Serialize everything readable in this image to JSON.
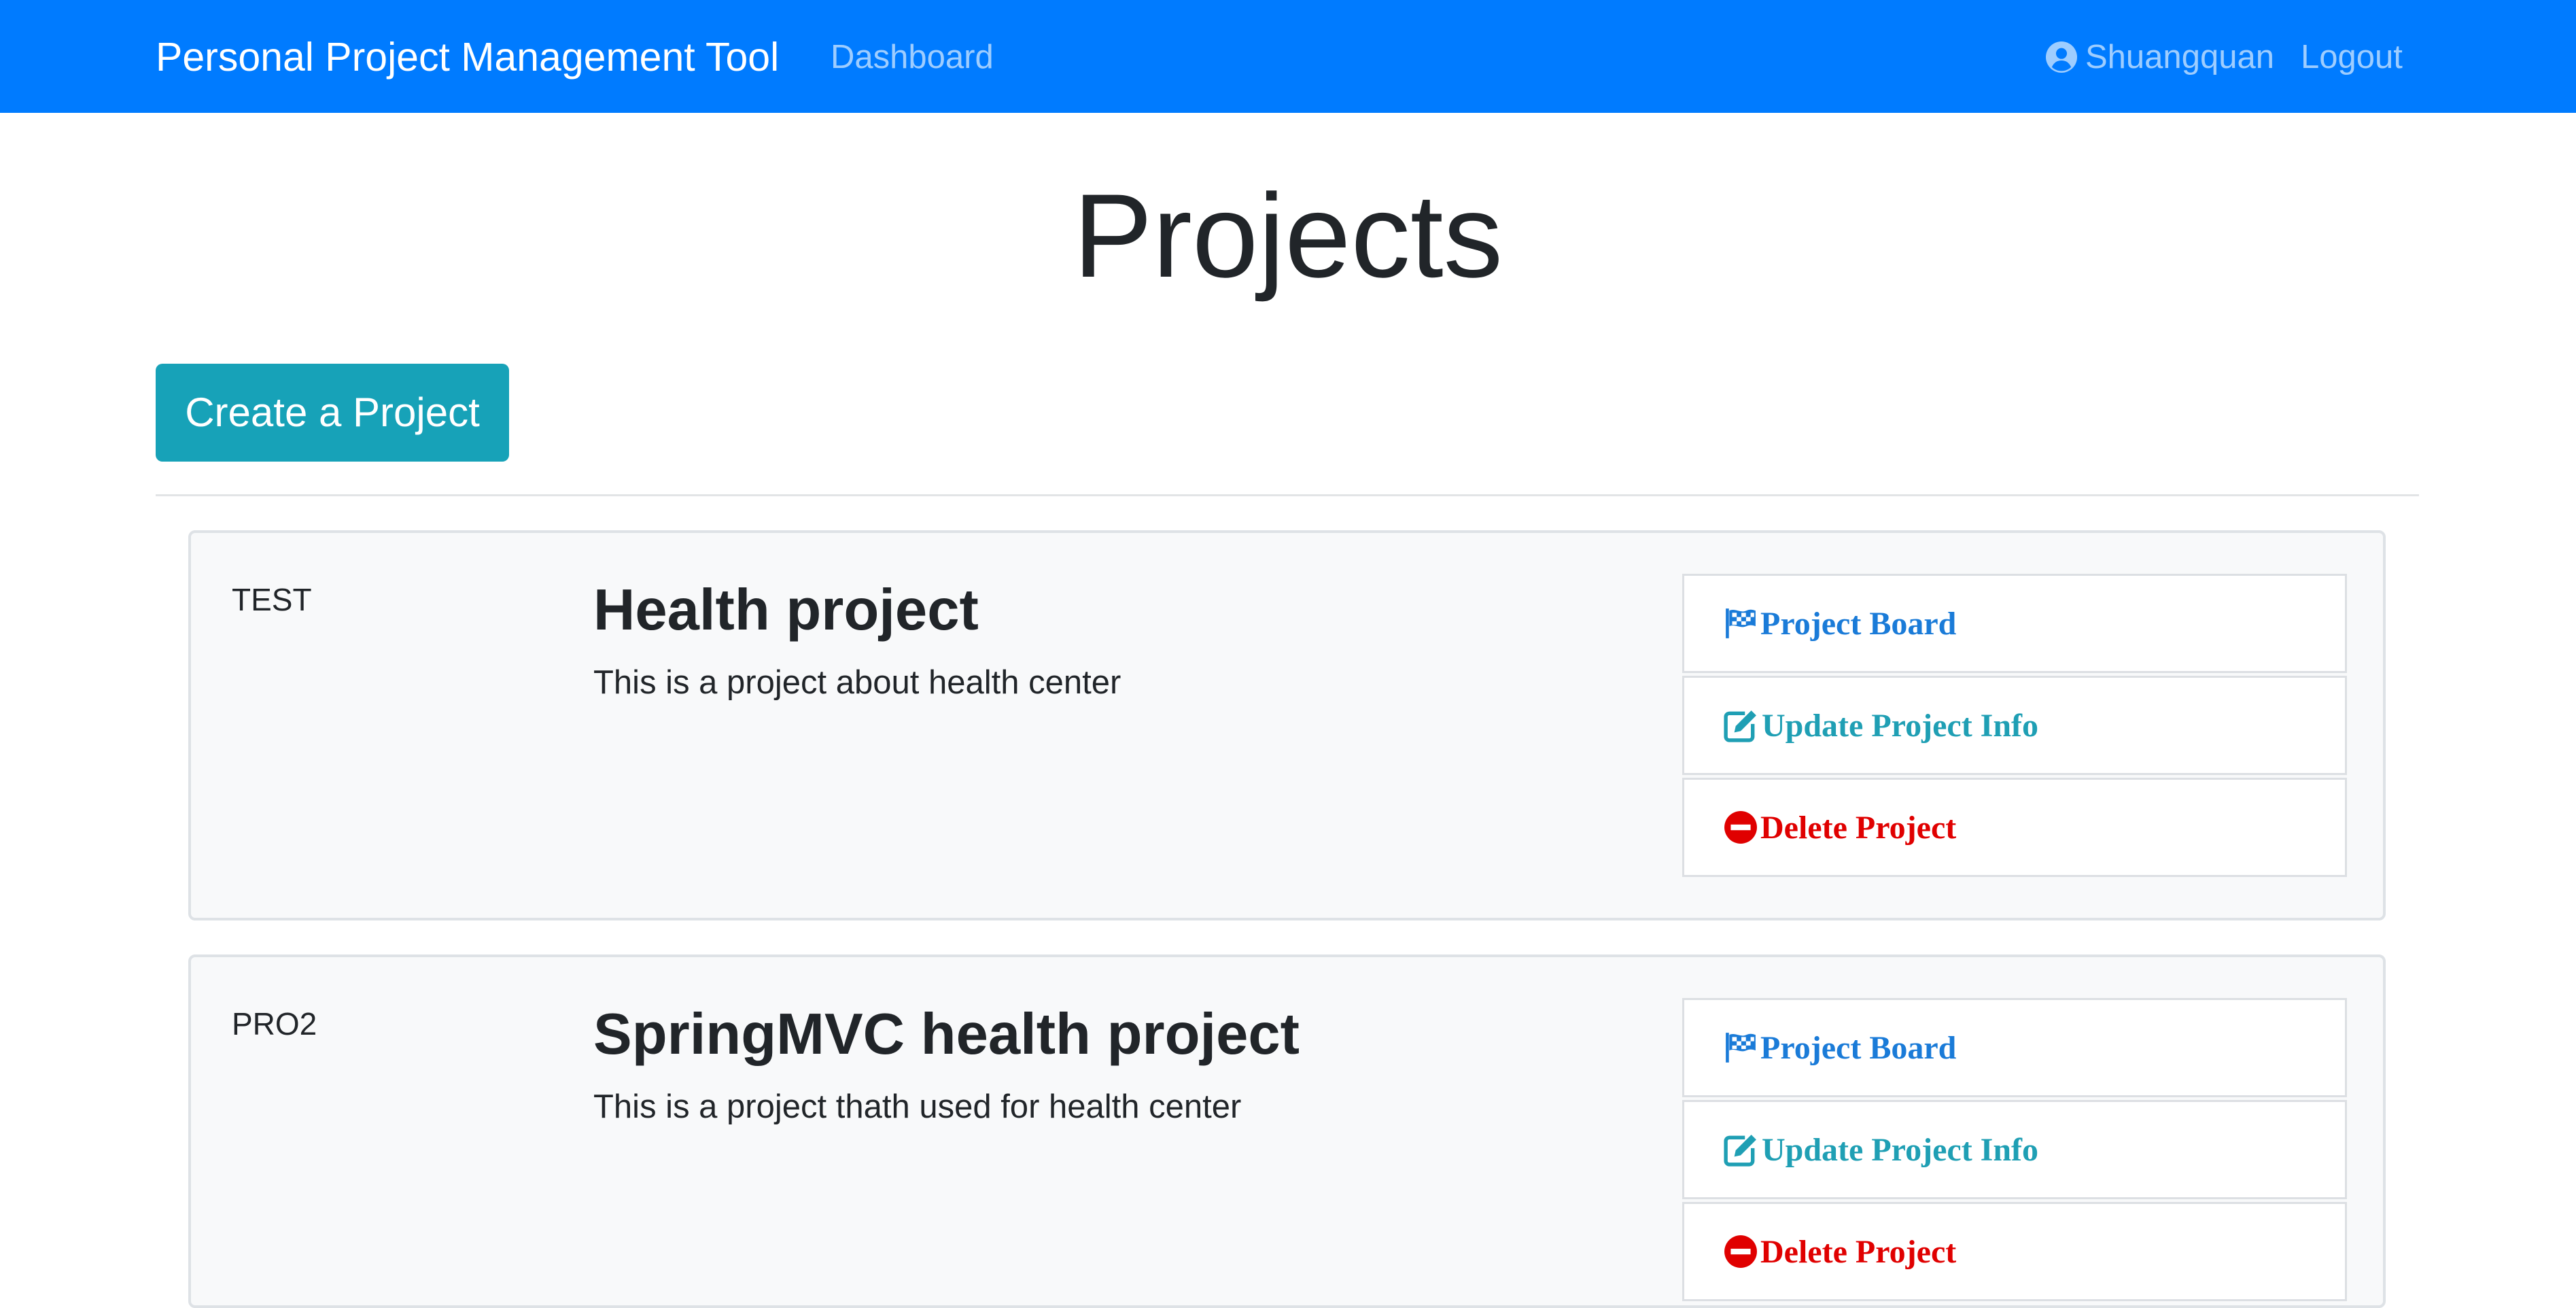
{
  "navbar": {
    "brand": "Personal Project Management Tool",
    "dashboard_link": "Dashboard",
    "user_name": "Shuangquan",
    "logout_link": "Logout"
  },
  "page": {
    "title": "Projects",
    "create_button": "Create a Project"
  },
  "projects": [
    {
      "identifier": "TEST",
      "name": "Health project",
      "description": "This is a project about health center",
      "actions": {
        "board": "Project Board",
        "update": "Update Project Info",
        "delete": "Delete Project"
      }
    },
    {
      "identifier": "PRO2",
      "name": "SpringMVC health project",
      "description": "This is a project thath used for health center",
      "actions": {
        "board": "Project Board",
        "update": "Update Project Info",
        "delete": "Delete Project"
      }
    }
  ],
  "colors": {
    "navbar": "#007bff",
    "create_button": "#17a2b8",
    "board_action": "#1a7bd8",
    "update_action": "#1f9fb4",
    "delete_action": "#e00000"
  },
  "icons": {
    "user": "user-circle-icon",
    "board": "flag-checkered-icon",
    "update": "edit-icon",
    "delete": "minus-circle-icon"
  }
}
